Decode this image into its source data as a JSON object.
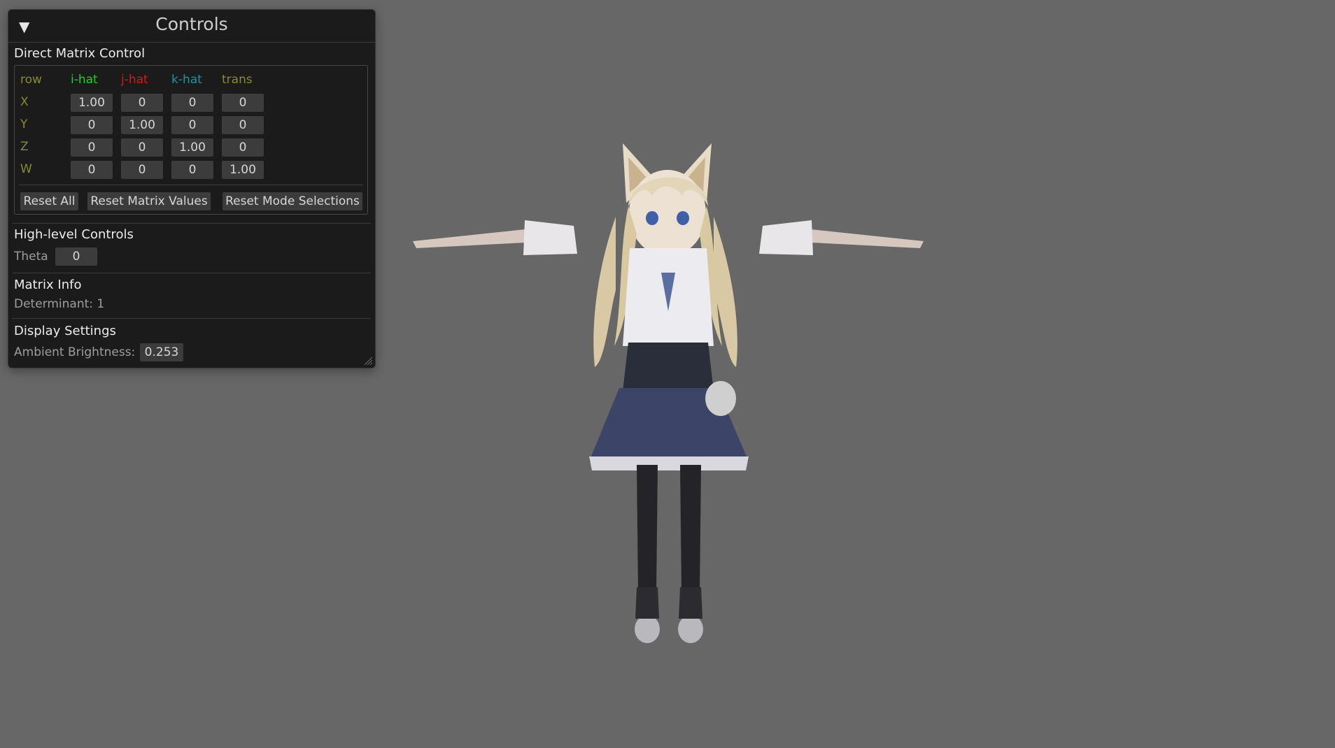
{
  "panel": {
    "title": "Controls",
    "collapse_glyph": "▼",
    "collapse_icon": "triangle-down-icon"
  },
  "matrix": {
    "section_title": "Direct Matrix Control",
    "headers": [
      "row",
      "i-hat",
      "j-hat",
      "k-hat",
      "trans"
    ],
    "header_colors": [
      "#8a8a2e",
      "#19d619",
      "#d61919",
      "#1a95a6",
      "#8a8a2e"
    ],
    "row_label_color": "#8a8a2e",
    "rows": [
      {
        "label": "X",
        "values": [
          "1.00",
          "0",
          "0",
          "0"
        ]
      },
      {
        "label": "Y",
        "values": [
          "0",
          "1.00",
          "0",
          "0"
        ]
      },
      {
        "label": "Z",
        "values": [
          "0",
          "0",
          "1.00",
          "0"
        ]
      },
      {
        "label": "W",
        "values": [
          "0",
          "0",
          "0",
          "1.00"
        ]
      }
    ],
    "buttons": {
      "reset_all": "Reset All",
      "reset_matrix": "Reset Matrix Values",
      "reset_modes": "Reset Mode Selections"
    }
  },
  "high_level": {
    "section_title": "High-level Controls",
    "theta_label": "Theta",
    "theta_value": "0"
  },
  "matrix_info": {
    "section_title": "Matrix Info",
    "determinant": "Determinant: 1"
  },
  "display": {
    "section_title": "Display Settings",
    "ambient_label": "Ambient Brightness:",
    "ambient_value": "0.253"
  },
  "colors": {
    "viewport_bg": "#676767",
    "panel_bg": "#1b1b1b",
    "widget_bg": "#3c3c3c"
  }
}
